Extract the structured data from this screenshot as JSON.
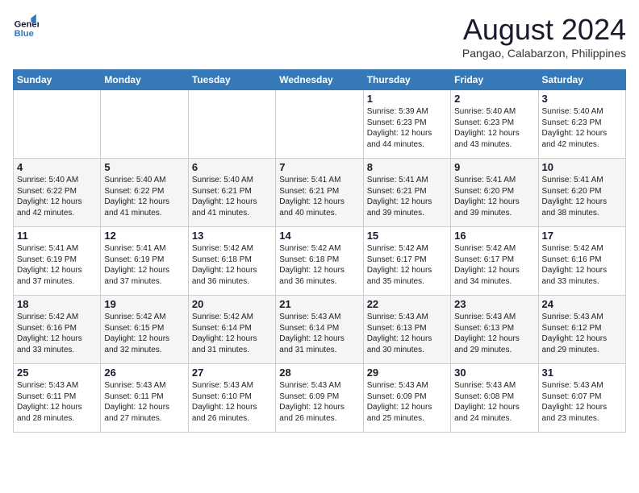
{
  "header": {
    "logo_line1": "General",
    "logo_line2": "Blue",
    "month": "August 2024",
    "location": "Pangao, Calabarzon, Philippines"
  },
  "weekdays": [
    "Sunday",
    "Monday",
    "Tuesday",
    "Wednesday",
    "Thursday",
    "Friday",
    "Saturday"
  ],
  "weeks": [
    [
      {
        "day": "",
        "info": ""
      },
      {
        "day": "",
        "info": ""
      },
      {
        "day": "",
        "info": ""
      },
      {
        "day": "",
        "info": ""
      },
      {
        "day": "1",
        "info": "Sunrise: 5:39 AM\nSunset: 6:23 PM\nDaylight: 12 hours\nand 44 minutes."
      },
      {
        "day": "2",
        "info": "Sunrise: 5:40 AM\nSunset: 6:23 PM\nDaylight: 12 hours\nand 43 minutes."
      },
      {
        "day": "3",
        "info": "Sunrise: 5:40 AM\nSunset: 6:23 PM\nDaylight: 12 hours\nand 42 minutes."
      }
    ],
    [
      {
        "day": "4",
        "info": "Sunrise: 5:40 AM\nSunset: 6:22 PM\nDaylight: 12 hours\nand 42 minutes."
      },
      {
        "day": "5",
        "info": "Sunrise: 5:40 AM\nSunset: 6:22 PM\nDaylight: 12 hours\nand 41 minutes."
      },
      {
        "day": "6",
        "info": "Sunrise: 5:40 AM\nSunset: 6:21 PM\nDaylight: 12 hours\nand 41 minutes."
      },
      {
        "day": "7",
        "info": "Sunrise: 5:41 AM\nSunset: 6:21 PM\nDaylight: 12 hours\nand 40 minutes."
      },
      {
        "day": "8",
        "info": "Sunrise: 5:41 AM\nSunset: 6:21 PM\nDaylight: 12 hours\nand 39 minutes."
      },
      {
        "day": "9",
        "info": "Sunrise: 5:41 AM\nSunset: 6:20 PM\nDaylight: 12 hours\nand 39 minutes."
      },
      {
        "day": "10",
        "info": "Sunrise: 5:41 AM\nSunset: 6:20 PM\nDaylight: 12 hours\nand 38 minutes."
      }
    ],
    [
      {
        "day": "11",
        "info": "Sunrise: 5:41 AM\nSunset: 6:19 PM\nDaylight: 12 hours\nand 37 minutes."
      },
      {
        "day": "12",
        "info": "Sunrise: 5:41 AM\nSunset: 6:19 PM\nDaylight: 12 hours\nand 37 minutes."
      },
      {
        "day": "13",
        "info": "Sunrise: 5:42 AM\nSunset: 6:18 PM\nDaylight: 12 hours\nand 36 minutes."
      },
      {
        "day": "14",
        "info": "Sunrise: 5:42 AM\nSunset: 6:18 PM\nDaylight: 12 hours\nand 36 minutes."
      },
      {
        "day": "15",
        "info": "Sunrise: 5:42 AM\nSunset: 6:17 PM\nDaylight: 12 hours\nand 35 minutes."
      },
      {
        "day": "16",
        "info": "Sunrise: 5:42 AM\nSunset: 6:17 PM\nDaylight: 12 hours\nand 34 minutes."
      },
      {
        "day": "17",
        "info": "Sunrise: 5:42 AM\nSunset: 6:16 PM\nDaylight: 12 hours\nand 33 minutes."
      }
    ],
    [
      {
        "day": "18",
        "info": "Sunrise: 5:42 AM\nSunset: 6:16 PM\nDaylight: 12 hours\nand 33 minutes."
      },
      {
        "day": "19",
        "info": "Sunrise: 5:42 AM\nSunset: 6:15 PM\nDaylight: 12 hours\nand 32 minutes."
      },
      {
        "day": "20",
        "info": "Sunrise: 5:42 AM\nSunset: 6:14 PM\nDaylight: 12 hours\nand 31 minutes."
      },
      {
        "day": "21",
        "info": "Sunrise: 5:43 AM\nSunset: 6:14 PM\nDaylight: 12 hours\nand 31 minutes."
      },
      {
        "day": "22",
        "info": "Sunrise: 5:43 AM\nSunset: 6:13 PM\nDaylight: 12 hours\nand 30 minutes."
      },
      {
        "day": "23",
        "info": "Sunrise: 5:43 AM\nSunset: 6:13 PM\nDaylight: 12 hours\nand 29 minutes."
      },
      {
        "day": "24",
        "info": "Sunrise: 5:43 AM\nSunset: 6:12 PM\nDaylight: 12 hours\nand 29 minutes."
      }
    ],
    [
      {
        "day": "25",
        "info": "Sunrise: 5:43 AM\nSunset: 6:11 PM\nDaylight: 12 hours\nand 28 minutes."
      },
      {
        "day": "26",
        "info": "Sunrise: 5:43 AM\nSunset: 6:11 PM\nDaylight: 12 hours\nand 27 minutes."
      },
      {
        "day": "27",
        "info": "Sunrise: 5:43 AM\nSunset: 6:10 PM\nDaylight: 12 hours\nand 26 minutes."
      },
      {
        "day": "28",
        "info": "Sunrise: 5:43 AM\nSunset: 6:09 PM\nDaylight: 12 hours\nand 26 minutes."
      },
      {
        "day": "29",
        "info": "Sunrise: 5:43 AM\nSunset: 6:09 PM\nDaylight: 12 hours\nand 25 minutes."
      },
      {
        "day": "30",
        "info": "Sunrise: 5:43 AM\nSunset: 6:08 PM\nDaylight: 12 hours\nand 24 minutes."
      },
      {
        "day": "31",
        "info": "Sunrise: 5:43 AM\nSunset: 6:07 PM\nDaylight: 12 hours\nand 23 minutes."
      }
    ]
  ]
}
